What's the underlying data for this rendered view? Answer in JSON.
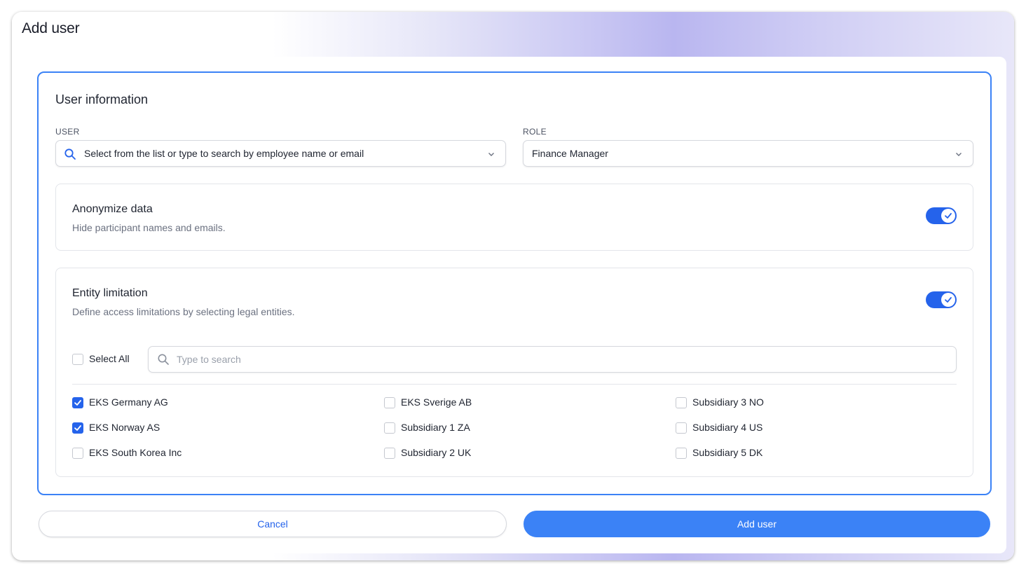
{
  "modal": {
    "title": "Add user"
  },
  "section": {
    "title": "User information"
  },
  "user_field": {
    "label": "USER",
    "placeholder": "Select from the list or type to search by employee name or email",
    "icon": "search-icon"
  },
  "role_field": {
    "label": "ROLE",
    "value": "Finance Manager"
  },
  "anonymize": {
    "title": "Anonymize data",
    "description": "Hide participant names and emails.",
    "enabled": true
  },
  "entity": {
    "title": "Entity limitation",
    "description": "Define access limitations by selecting legal entities.",
    "enabled": true,
    "select_all_label": "Select All",
    "search_placeholder": "Type to search",
    "entities": [
      {
        "label": "EKS Germany AG",
        "checked": true
      },
      {
        "label": "EKS Norway AS",
        "checked": true
      },
      {
        "label": "EKS South Korea Inc",
        "checked": false
      },
      {
        "label": "EKS Sverige AB",
        "checked": false
      },
      {
        "label": "Subsidiary 1 ZA",
        "checked": false
      },
      {
        "label": "Subsidiary 2 UK",
        "checked": false
      },
      {
        "label": "Subsidiary 3 NO",
        "checked": false
      },
      {
        "label": "Subsidiary 4 US",
        "checked": false
      },
      {
        "label": "Subsidiary 5 DK",
        "checked": false
      }
    ]
  },
  "actions": {
    "cancel_label": "Cancel",
    "add_label": "Add user"
  },
  "colors": {
    "primary": "#2563eb",
    "button": "#3b82f6",
    "frame_border": "#3b82f6"
  }
}
